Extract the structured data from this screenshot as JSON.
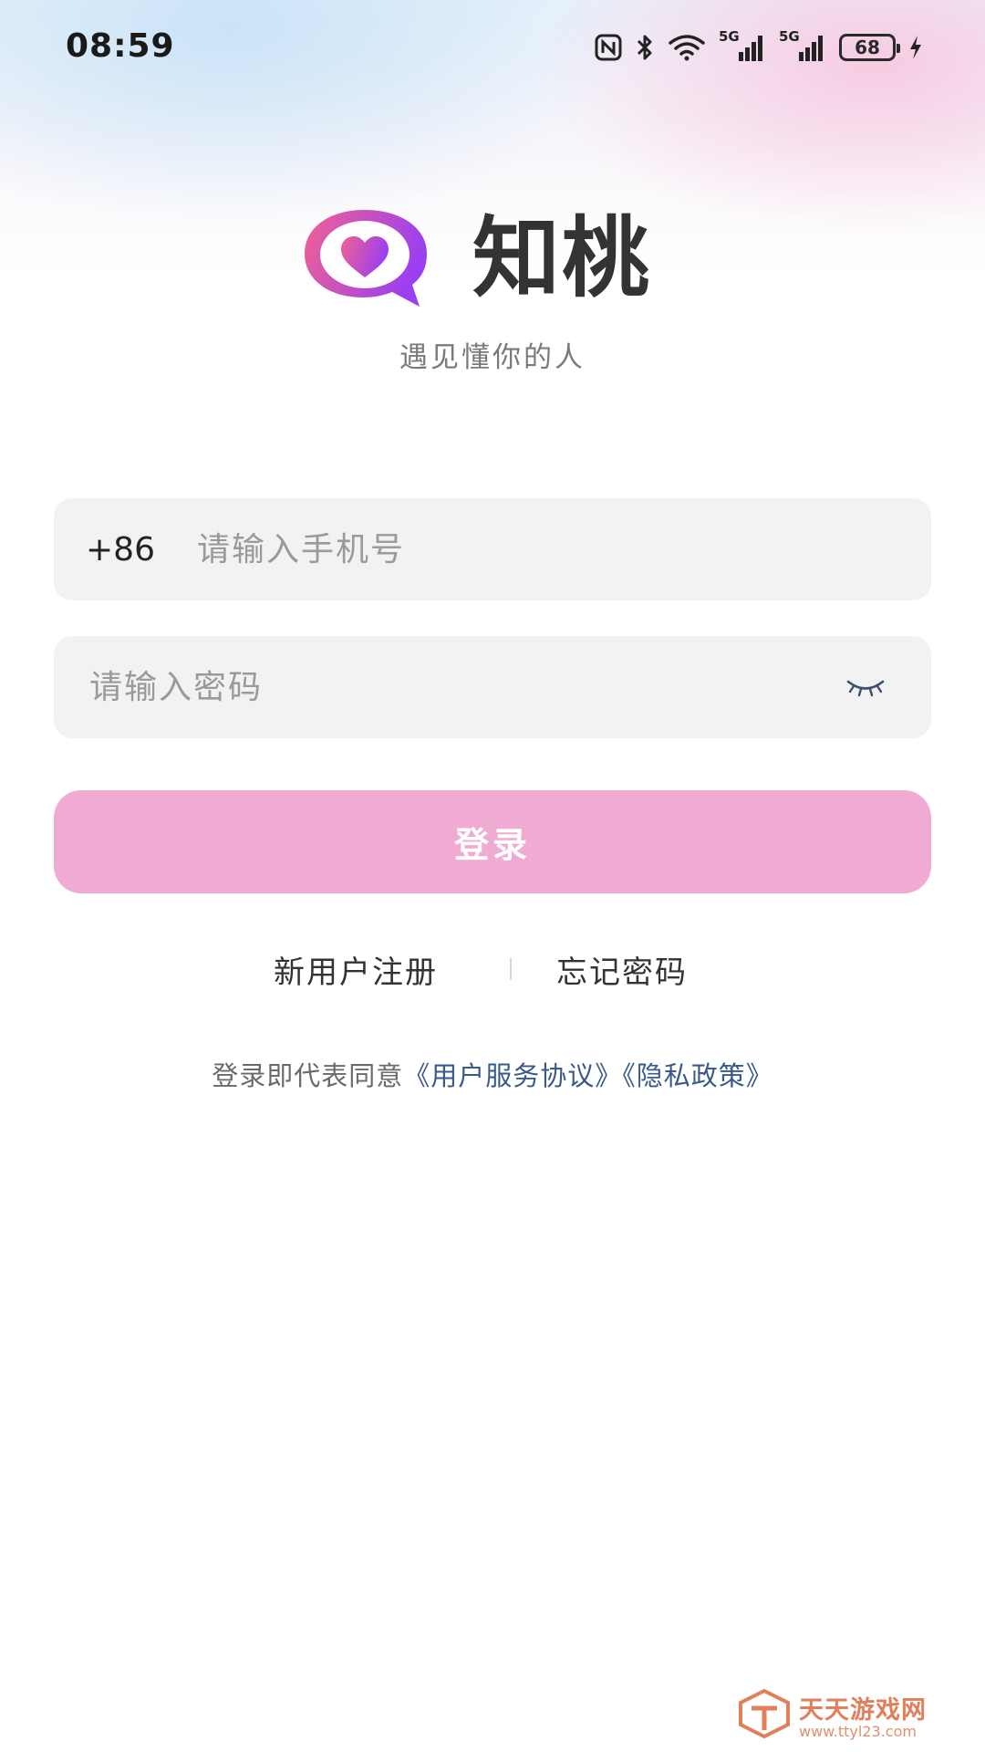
{
  "status_bar": {
    "time": "08:59",
    "network_1": "5G",
    "network_2": "5G",
    "battery": "68",
    "icons": [
      "nfc-icon",
      "bluetooth-icon",
      "wifi-icon",
      "signal-icon",
      "signal-icon",
      "battery-icon",
      "charging-icon"
    ]
  },
  "brand": {
    "app_name": "知桃",
    "slogan": "遇见懂你的人",
    "logo_icon": "heart-chat-bubble-icon",
    "logo_colors": [
      "#f06292",
      "#9c3ff0"
    ]
  },
  "login_form": {
    "country_code": "+86",
    "phone_placeholder": "请输入手机号",
    "password_placeholder": "请输入密码",
    "password_toggle_icon": "eye-closed-icon",
    "login_label": "登录",
    "login_color": "#efabd1"
  },
  "links": {
    "register": "新用户注册",
    "forgot": "忘记密码"
  },
  "agreement": {
    "prefix": "登录即代表同意",
    "terms": "《用户服务协议》",
    "privacy": "《隐私政策》"
  },
  "watermark": {
    "title": "天天游戏网",
    "url": "www.ttyl23.com"
  }
}
